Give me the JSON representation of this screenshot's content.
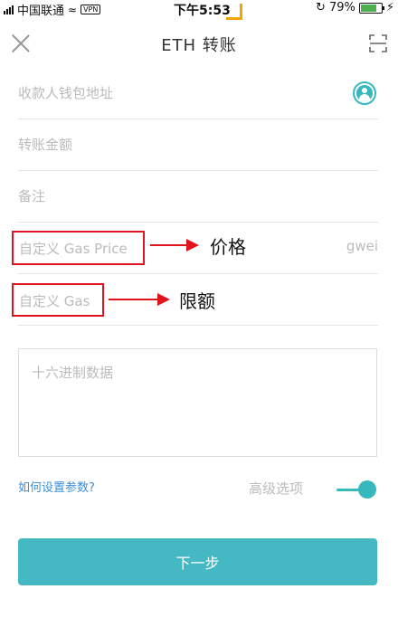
{
  "status_bar": {
    "carrier": "中国联通",
    "vpn": "VPN",
    "time": "下午5:53",
    "battery_percent": "79%",
    "battery_level": 0.79
  },
  "header": {
    "title": "ETH 转账",
    "close_icon": "close-icon",
    "scan_icon": "scan-icon"
  },
  "form": {
    "recipient_placeholder": "收款人钱包地址",
    "amount_placeholder": "转账金额",
    "memo_placeholder": "备注",
    "gas_price_placeholder": "自定义 Gas Price",
    "gas_price_unit": "gwei",
    "gas_limit_placeholder": "自定义 Gas",
    "hex_data_placeholder": "十六进制数据"
  },
  "annotations": {
    "price_label": "价格",
    "limit_label": "限额",
    "color": "#e0141e"
  },
  "options": {
    "help_link": "如何设置参数?",
    "advanced_label": "高级选项",
    "advanced_enabled": true
  },
  "actions": {
    "next_label": "下一步"
  },
  "colors": {
    "accent": "#44b9c3",
    "link": "#3a8fd9"
  }
}
